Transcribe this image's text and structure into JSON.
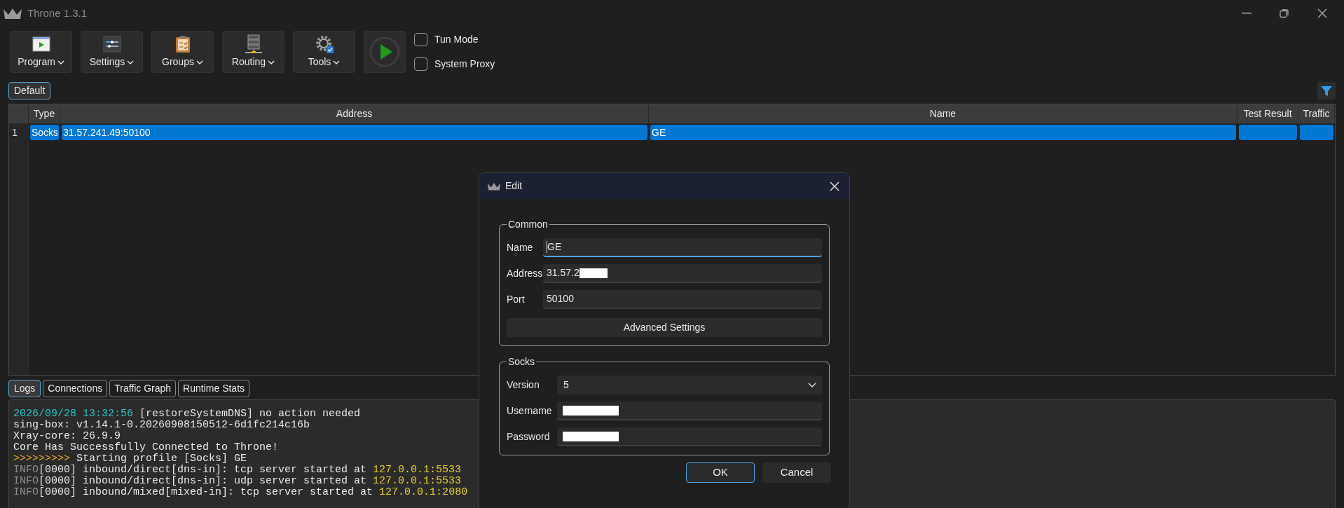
{
  "window": {
    "title": "Throne 1.3.1"
  },
  "toolbar": [
    {
      "label": "Program"
    },
    {
      "label": "Settings"
    },
    {
      "label": "Groups"
    },
    {
      "label": "Routing"
    },
    {
      "label": "Tools"
    }
  ],
  "toggles": [
    {
      "label": "Tun Mode",
      "checked": false
    },
    {
      "label": "System Proxy",
      "checked": false
    }
  ],
  "group_tabs": [
    {
      "label": "Default",
      "selected": true
    }
  ],
  "table": {
    "columns": [
      "Type",
      "Address",
      "Name",
      "Test Result",
      "Traffic"
    ],
    "rows": [
      {
        "number": "1",
        "type": "Socks",
        "address": "31.57.241.49:50100",
        "name": "GE",
        "selected": true
      }
    ]
  },
  "bottom_tabs": [
    {
      "label": "Logs",
      "selected": true
    },
    {
      "label": "Connections",
      "selected": false
    },
    {
      "label": "Traffic Graph",
      "selected": false
    },
    {
      "label": "Runtime Stats",
      "selected": false
    }
  ],
  "logs": [
    [
      {
        "kind": "time",
        "text": "2026/09/28 13:32:56"
      },
      {
        "kind": "plain",
        "text": " [restoreSystemDNS] no action needed"
      }
    ],
    [
      {
        "kind": "plain",
        "text": "sing-box: v1.14.1-0.20260908150512-6d1fc214c16b"
      }
    ],
    [
      {
        "kind": "plain",
        "text": "Xray-core: 26.9.9"
      }
    ],
    [
      {
        "kind": "plain",
        "text": "Core Has Successfully Connected to Throne!"
      }
    ],
    [
      {
        "kind": "arrow",
        "text": ">>>>>>>>>"
      },
      {
        "kind": "plain",
        "text": " Starting profile [Socks] GE"
      }
    ],
    [
      {
        "kind": "level",
        "text": "INFO"
      },
      {
        "kind": "plain",
        "text": "[0000] inbound/direct[dns-in]: tcp server started at "
      },
      {
        "kind": "address",
        "text": "127.0.0.1:5533"
      }
    ],
    [
      {
        "kind": "level",
        "text": "INFO"
      },
      {
        "kind": "plain",
        "text": "[0000] inbound/direct[dns-in]: udp server started at "
      },
      {
        "kind": "address",
        "text": "127.0.0.1:5533"
      }
    ],
    [
      {
        "kind": "level",
        "text": "INFO"
      },
      {
        "kind": "plain",
        "text": "[0000] inbound/mixed[mixed-in]: tcp server started at "
      },
      {
        "kind": "address",
        "text": "127.0.0.1:2080"
      }
    ]
  ],
  "dialog": {
    "title": "Edit",
    "groups": [
      {
        "title": "Common",
        "fields": [
          {
            "label": "Name",
            "kind": "text",
            "value": "GE",
            "focused": true
          },
          {
            "label": "Address",
            "kind": "text",
            "value": "31.57.2",
            "redacted": true
          },
          {
            "label": "Port",
            "kind": "text",
            "value": "50100"
          }
        ],
        "button": "Advanced Settings"
      },
      {
        "title": "Socks",
        "fields": [
          {
            "label": "Version",
            "kind": "select",
            "value": "5"
          },
          {
            "label": "Username",
            "kind": "text",
            "redacted": true
          },
          {
            "label": "Password",
            "kind": "text",
            "redacted": true
          }
        ]
      }
    ],
    "buttons": [
      {
        "label": "OK",
        "default": true
      },
      {
        "label": "Cancel",
        "default": false
      }
    ]
  }
}
